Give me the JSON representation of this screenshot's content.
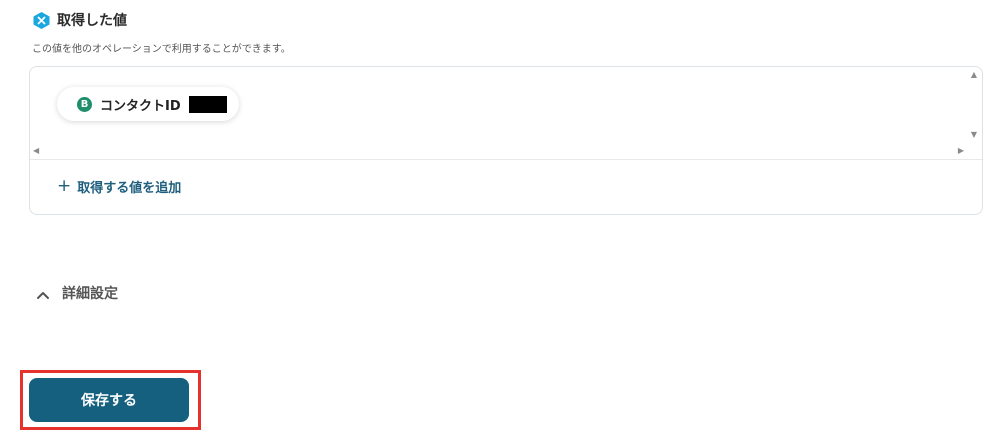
{
  "section": {
    "title": "取得した値",
    "description": "この値を他のオペレーションで利用することができます。",
    "icon": "x-badge-icon"
  },
  "values": {
    "chip": {
      "label": "コンタクトID",
      "icon_letter": "B",
      "icon_color": "#1e8e6b"
    },
    "add_label": "取得する値を追加"
  },
  "details": {
    "label": "詳細設定"
  },
  "save": {
    "label": "保存する",
    "color": "#15607f",
    "highlight_color": "#e5322d"
  },
  "colors": {
    "accent": "#1f5f7d",
    "title_icon": "#1aa7e0"
  }
}
